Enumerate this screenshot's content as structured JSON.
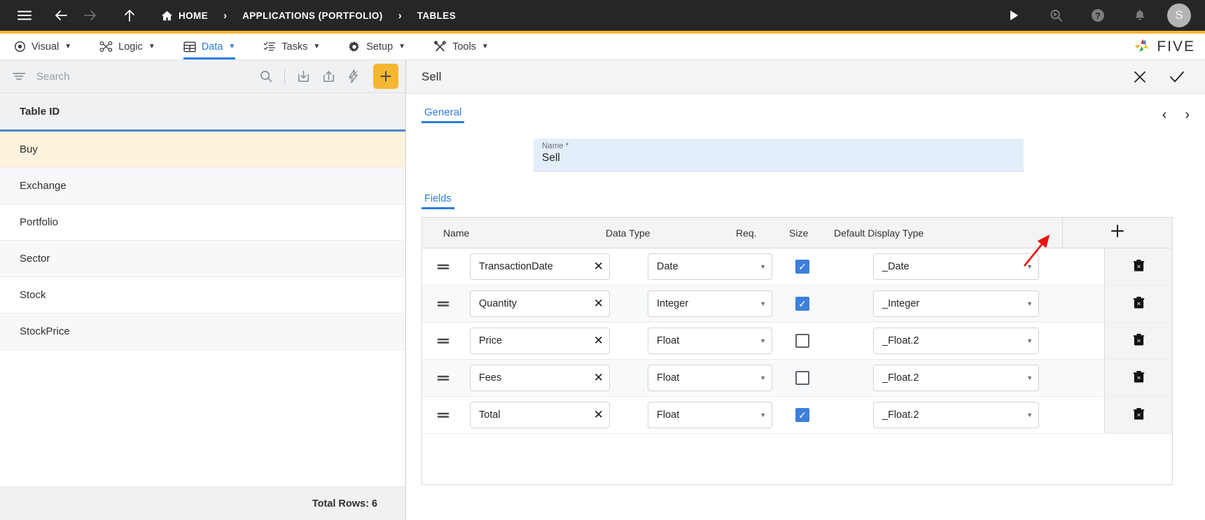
{
  "topbar": {
    "menu_icon": "hamburger-icon",
    "back_icon": "arrow-left-icon",
    "forward_icon": "arrow-right-icon",
    "up_icon": "arrow-up-icon",
    "home_icon": "home-icon",
    "breadcrumbs": [
      {
        "label": "HOME",
        "has_icon": true
      },
      {
        "label": "APPLICATIONS (PORTFOLIO)",
        "has_icon": false
      },
      {
        "label": "TABLES",
        "has_icon": false
      }
    ],
    "separator": "›",
    "actions": [
      {
        "name": "run-icon",
        "glyph": "▶"
      },
      {
        "name": "search-magnifier-icon",
        "glyph": "search"
      },
      {
        "name": "help-icon",
        "glyph": "?"
      },
      {
        "name": "notifications-bell-icon",
        "glyph": "bell"
      }
    ],
    "avatar_initial": "S",
    "accent_bar_color": "#F5B731"
  },
  "menubar": {
    "items": [
      {
        "label": "Visual",
        "icon": "eye-icon",
        "active": false
      },
      {
        "label": "Logic",
        "icon": "logic-nodes-icon",
        "active": false
      },
      {
        "label": "Data",
        "icon": "table-grid-icon",
        "active": true
      },
      {
        "label": "Tasks",
        "icon": "checklist-icon",
        "active": false
      },
      {
        "label": "Setup",
        "icon": "gear-icon",
        "active": false
      },
      {
        "label": "Tools",
        "icon": "tools-icon",
        "active": false
      }
    ],
    "caret": "▼",
    "brand": "FIVE",
    "active_color": "#2b7de0"
  },
  "left_panel": {
    "search": {
      "placeholder": "Search",
      "value": "",
      "filter_icon": "filter-icon",
      "search_icon": "search-icon",
      "import_icon": "import-download-icon",
      "export_icon": "export-upload-icon",
      "lightning_icon": "lightning-bolt-icon",
      "add_label": "+",
      "add_color": "#F5B731"
    },
    "column_header": "Table ID",
    "rows": [
      {
        "label": "Buy",
        "selected": true
      },
      {
        "label": "Exchange",
        "selected": false
      },
      {
        "label": "Portfolio",
        "selected": false
      },
      {
        "label": "Sector",
        "selected": false
      },
      {
        "label": "Stock",
        "selected": false
      },
      {
        "label": "StockPrice",
        "selected": false
      }
    ],
    "footer": "Total Rows: 6",
    "selected_row_color": "#fdf3dd"
  },
  "right_panel": {
    "title": "Sell",
    "close_icon": "close-x-icon",
    "confirm_icon": "checkmark-icon",
    "tabs": [
      {
        "label": "General",
        "active": true
      }
    ],
    "pager": {
      "prev": "‹",
      "next": "›"
    },
    "name_field": {
      "label": "Name *",
      "value": "Sell"
    },
    "fields_section": {
      "tab_label": "Fields",
      "columns": [
        "Name",
        "Data Type",
        "Req.",
        "Size",
        "Default Display Type"
      ],
      "add_row_label": "+",
      "delete_icon": "trash-delete-icon",
      "drag_handle_icon": "drag-handle-icon",
      "clear-icon": "clear-x-icon",
      "rows": [
        {
          "name": "TransactionDate",
          "data_type": "Date",
          "required": true,
          "size": "",
          "display_type": "_Date"
        },
        {
          "name": "Quantity",
          "data_type": "Integer",
          "required": true,
          "size": "",
          "display_type": "_Integer"
        },
        {
          "name": "Price",
          "data_type": "Float",
          "required": false,
          "size": "",
          "display_type": "_Float.2"
        },
        {
          "name": "Fees",
          "data_type": "Float",
          "required": false,
          "size": "",
          "display_type": "_Float.2"
        },
        {
          "name": "Total",
          "data_type": "Float",
          "required": true,
          "size": "",
          "display_type": "_Float.2"
        }
      ]
    }
  },
  "annotation": {
    "arrow_color": "#ee1111",
    "points_to": "add-field-row-button"
  }
}
